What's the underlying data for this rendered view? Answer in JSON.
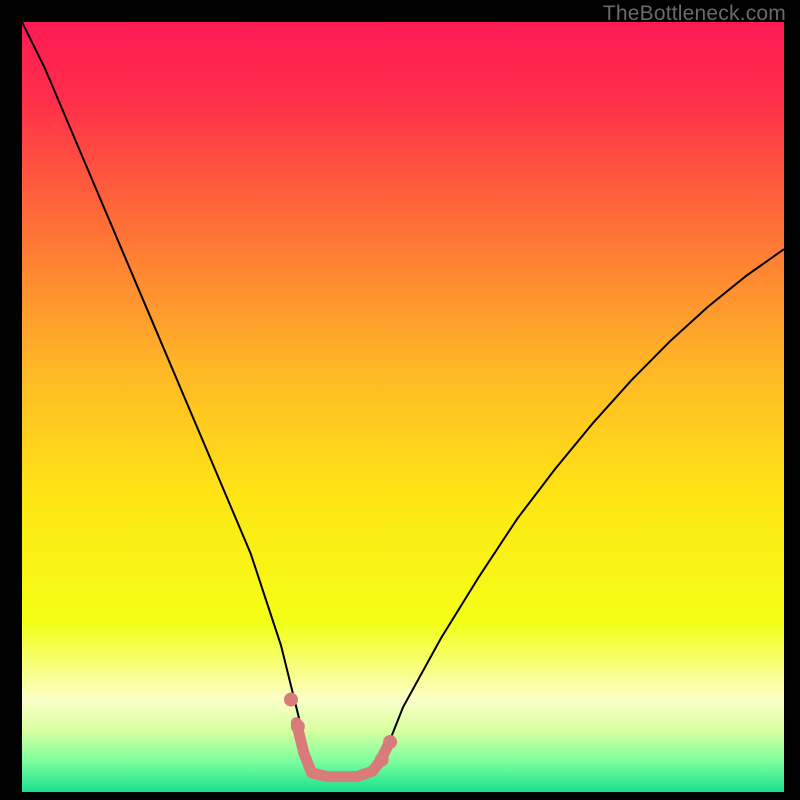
{
  "watermark": "TheBottleneck.com",
  "chart_data": {
    "type": "line",
    "title": "",
    "xlabel": "",
    "ylabel": "",
    "xlim": [
      0,
      100
    ],
    "ylim": [
      0,
      100
    ],
    "grid": false,
    "legend": false,
    "background": {
      "type": "vertical-gradient",
      "stops": [
        {
          "pos": 0.0,
          "color": "#ff1a55"
        },
        {
          "pos": 0.1,
          "color": "#ff2e4a"
        },
        {
          "pos": 0.25,
          "color": "#ff6a38"
        },
        {
          "pos": 0.45,
          "color": "#ffb726"
        },
        {
          "pos": 0.62,
          "color": "#ffe614"
        },
        {
          "pos": 0.78,
          "color": "#f3ff17"
        },
        {
          "pos": 0.88,
          "color": "#fbffc8"
        },
        {
          "pos": 0.92,
          "color": "#d8ffa0"
        },
        {
          "pos": 0.96,
          "color": "#7dff9e"
        },
        {
          "pos": 1.0,
          "color": "#18e08e"
        }
      ]
    },
    "series": [
      {
        "name": "bottleneck-curve",
        "stroke": "#000000",
        "stroke_width": 2,
        "x": [
          0,
          3,
          6,
          9,
          12,
          15,
          18,
          21,
          24,
          27,
          30,
          32,
          34,
          36.5,
          38,
          40,
          42,
          44,
          46,
          48,
          50,
          55,
          60,
          65,
          70,
          75,
          80,
          85,
          90,
          95,
          100
        ],
        "y": [
          100,
          94,
          87,
          80,
          73,
          66,
          59,
          52,
          45,
          38,
          31,
          25,
          19,
          9,
          2.5,
          2,
          2,
          2,
          2.7,
          6,
          11,
          20,
          28,
          35.5,
          42,
          48,
          53.5,
          58.5,
          63,
          67,
          70.5
        ]
      },
      {
        "name": "sweet-spot-band",
        "stroke": "#d97b7b",
        "stroke_width": 11,
        "linecap": "round",
        "x": [
          36,
          37,
          38,
          40,
          42,
          44,
          46,
          47,
          48
        ],
        "y": [
          9,
          5,
          2.5,
          2,
          2,
          2,
          2.7,
          4,
          6
        ]
      },
      {
        "name": "sweet-spot-dots",
        "type": "scatter",
        "marker_color": "#d97b7b",
        "marker_radius": 7,
        "x": [
          35.3,
          36.2,
          47.2,
          48.3
        ],
        "y": [
          12,
          8.5,
          4.2,
          6.5
        ]
      }
    ]
  }
}
